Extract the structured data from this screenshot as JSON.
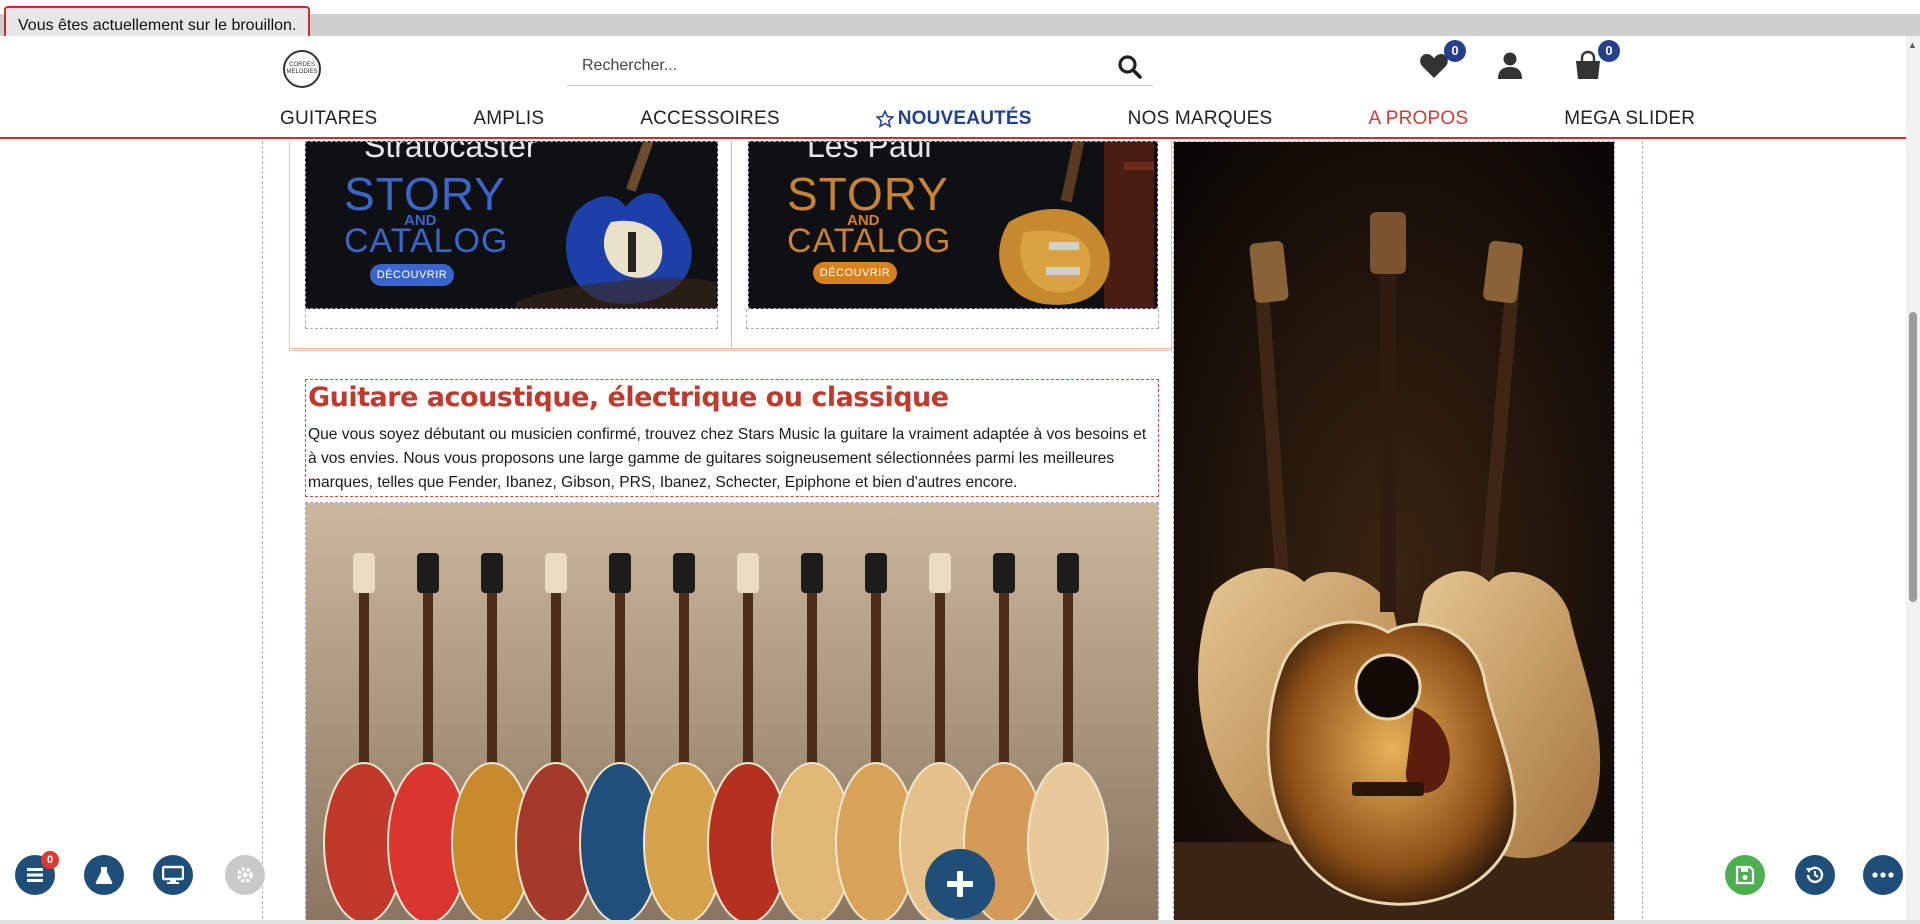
{
  "draft_notice": "Vous êtes actuellement sur le brouillon.",
  "header": {
    "logo_text": [
      "CORDES",
      "MELODIES"
    ],
    "search_placeholder": "Rechercher...",
    "wishlist_count": "0",
    "cart_count": "0"
  },
  "nav": {
    "items": [
      {
        "label": "GUITARES"
      },
      {
        "label": "AMPLIS"
      },
      {
        "label": "ACCESSOIRES"
      },
      {
        "label": "NOUVEAUTÉS",
        "icon": "star-outline-icon"
      },
      {
        "label": "NOS MARQUES"
      },
      {
        "label": "A PROPOS"
      },
      {
        "label": "MEGA SLIDER"
      }
    ]
  },
  "promos": [
    {
      "title": "Stratocaster",
      "story": "STORY",
      "and": "AND",
      "catalog": "CATALOG",
      "cta": "DÉCOUVRIR",
      "accent": "#3a66c9"
    },
    {
      "title": "Les Paul",
      "story": "STORY",
      "and": "AND",
      "catalog": "CATALOG",
      "cta": "DÉCOUVRIR",
      "accent": "#d9801f"
    }
  ],
  "section": {
    "heading": "Guitare acoustique, électrique ou classique",
    "body": "Que vous soyez débutant ou musicien confirmé, trouvez chez Stars Music la guitare la vraiment adaptée à vos besoins et à vos envies. Nous vous proposons une large gamme de guitares soigneusement sélectionnées parmi les meilleures marques, telles que Fender, Ibanez, Gibson, PRS, Ibanez, Schecter, Epiphone et bien d'autres encore."
  },
  "tools": {
    "layers_badge": "0"
  },
  "colors": {
    "brand_red": "#c0392b",
    "nav_blue": "#243f8e",
    "tool_dark": "#1f4e79",
    "save_green": "#4caf50"
  }
}
